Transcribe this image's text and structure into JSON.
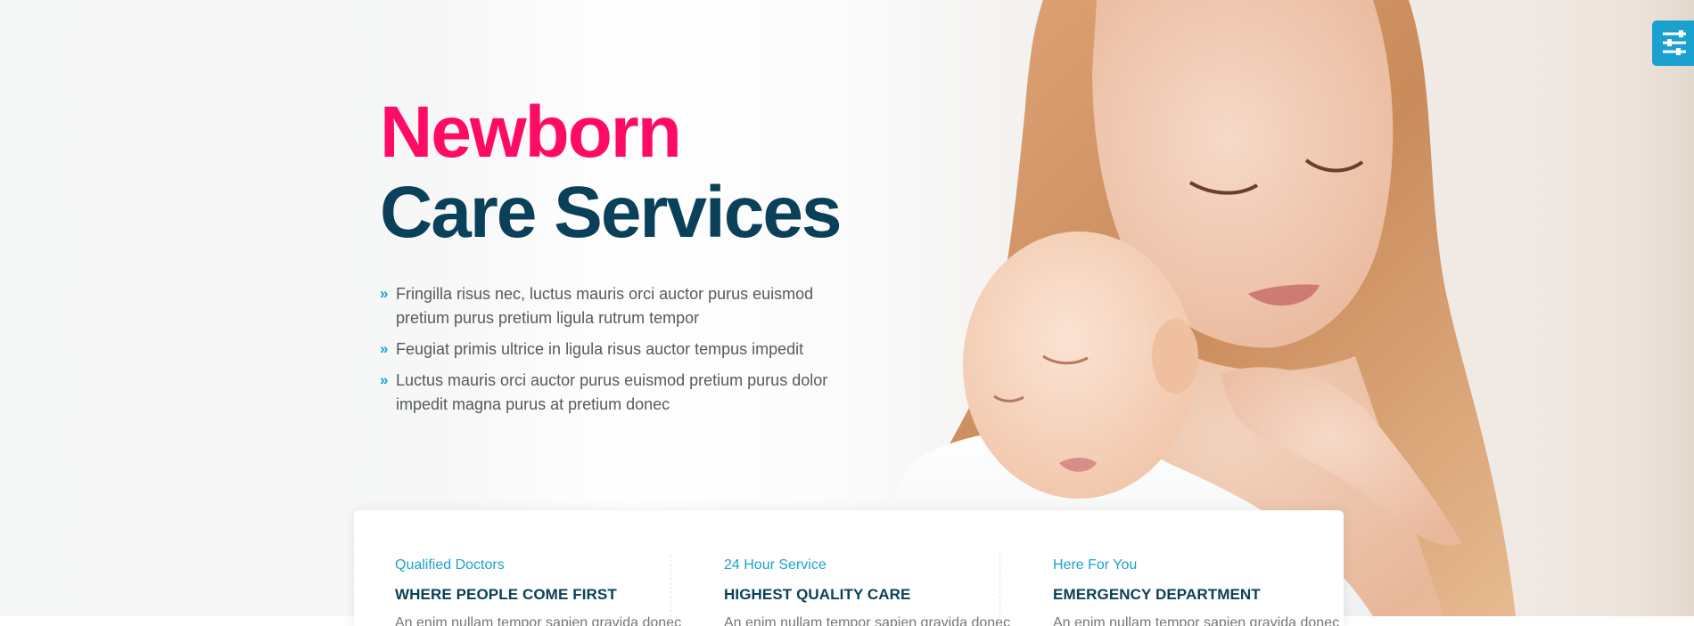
{
  "hero": {
    "headline_line1": "Newborn",
    "headline_line2": "Care Services",
    "bullets": [
      "Fringilla risus nec, luctus mauris orci auctor purus euismod pretium purus pretium ligula rutrum tempor",
      "Feugiat primis ultrice in ligula risus auctor tempus impedit",
      "Luctus mauris orci auctor purus euismod pretium purus dolor impedit magna purus at pretium donec"
    ],
    "bullet_icon": "double-chevron-right-icon"
  },
  "settings": {
    "icon": "sliders-icon"
  },
  "features": [
    {
      "subtitle": "Qualified Doctors",
      "title": "WHERE PEOPLE COME FIRST",
      "desc": "An enim nullam tempor sapien gravida donec"
    },
    {
      "subtitle": "24 Hour Service",
      "title": "HIGHEST QUALITY CARE",
      "desc": "An enim nullam tempor sapien gravida donec"
    },
    {
      "subtitle": "Here For You",
      "title": "EMERGENCY DEPARTMENT",
      "desc": "An enim nullam tempor sapien gravida donec"
    }
  ],
  "colors": {
    "accent_pink": "#ff0a64",
    "accent_navy": "#0a4059",
    "accent_blue": "#1ba1cf"
  }
}
